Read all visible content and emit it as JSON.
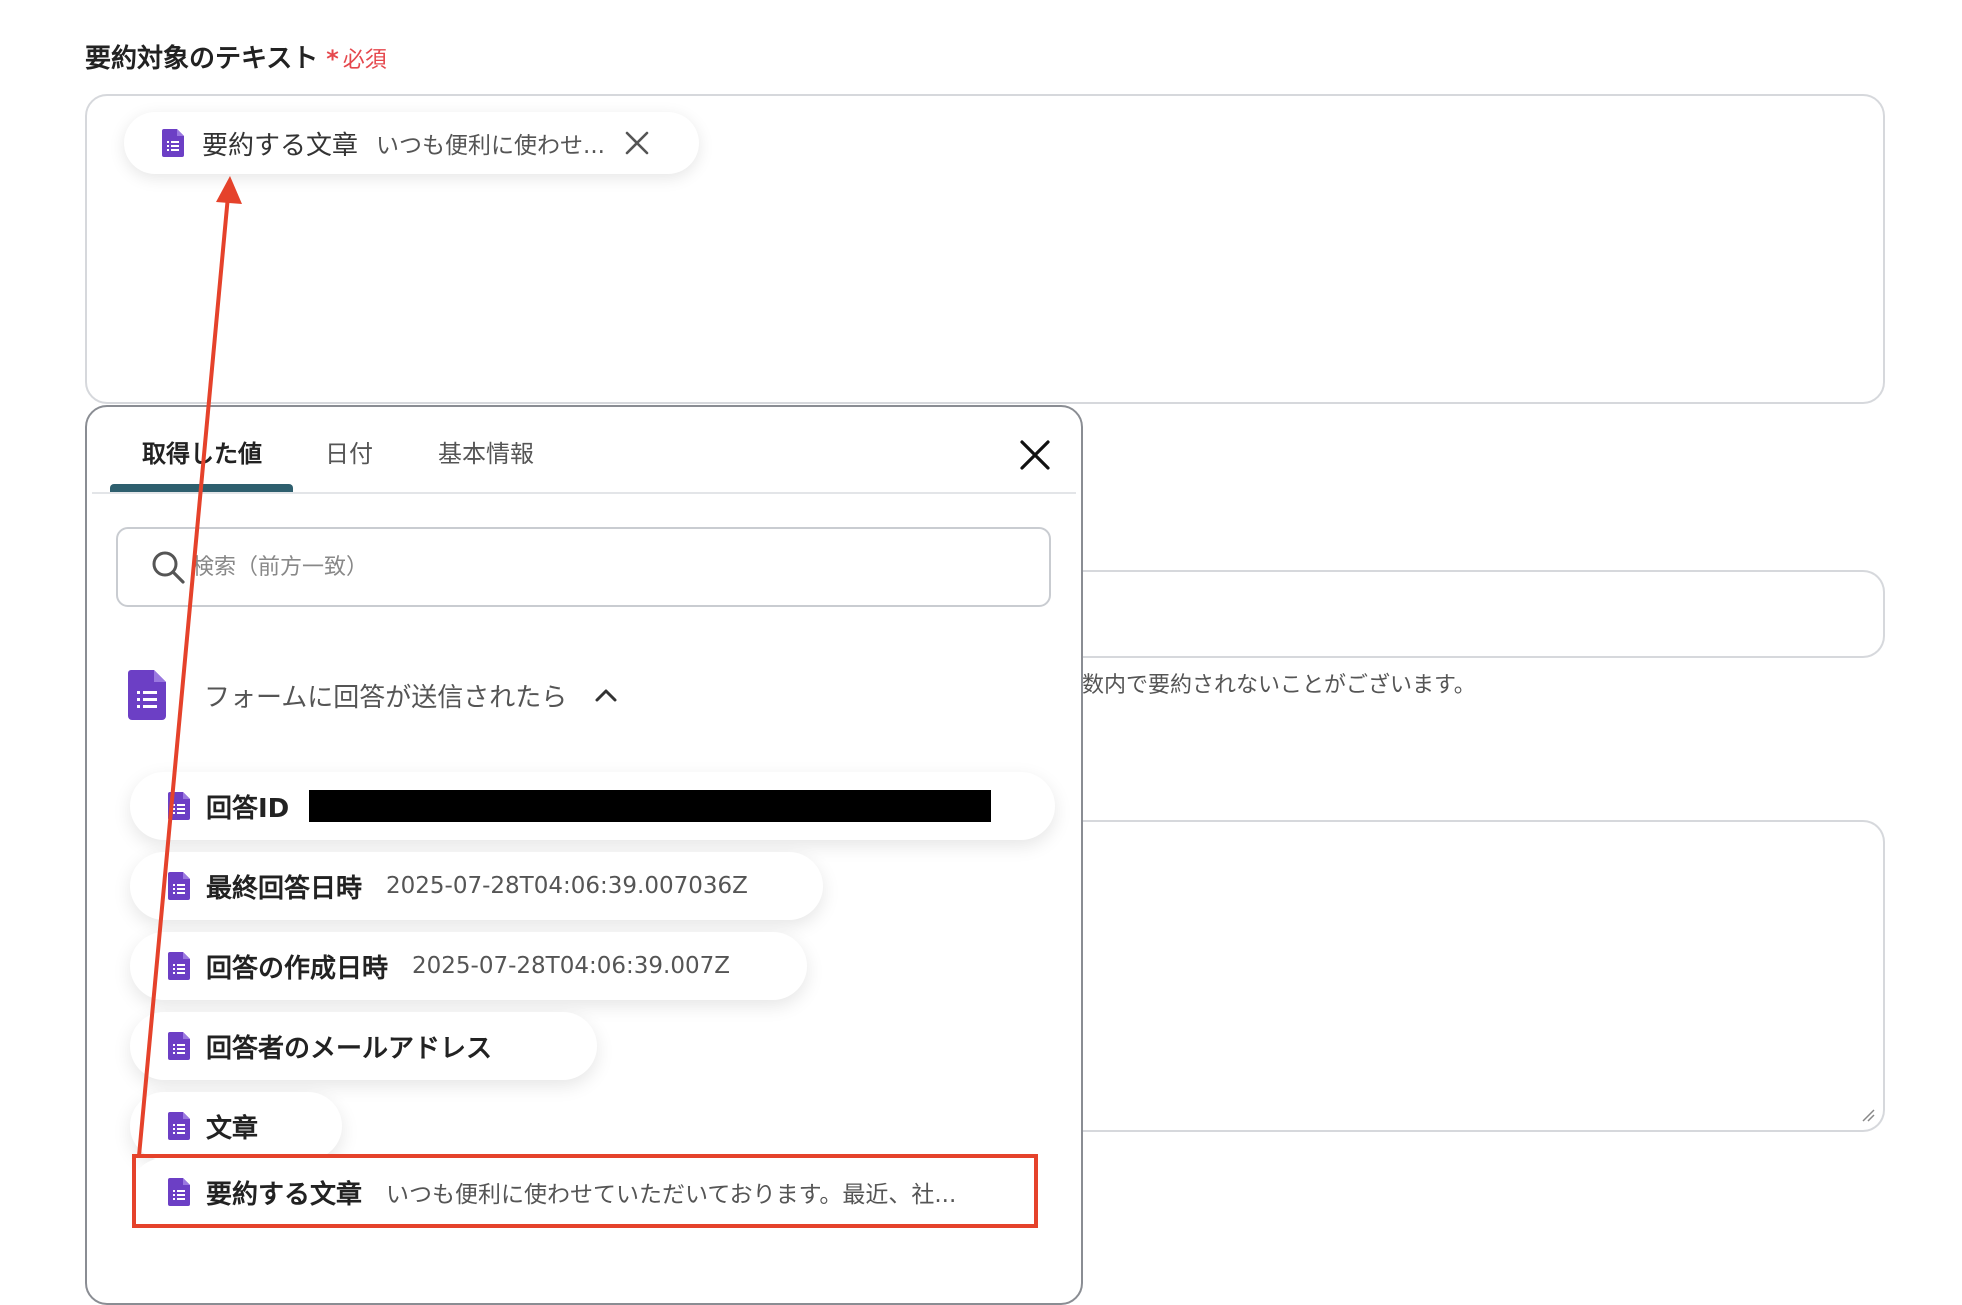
{
  "field": {
    "label": "要約対象のテキスト",
    "required_star": "*",
    "required_text": "必須"
  },
  "selected_chip": {
    "icon": "google-forms-doc-icon",
    "label": "要約する文章",
    "value": "いつも便利に使わせ...",
    "remove_icon": "close-icon"
  },
  "background": {
    "help_text": "数内で要約されないことがございます。"
  },
  "popup": {
    "tabs": [
      "取得した値",
      "日付",
      "基本情報"
    ],
    "active_tab": 0,
    "search_placeholder": "検索（前方一致）",
    "group": {
      "label": "フォームに回答が送信されたら",
      "expanded": true
    },
    "items": [
      {
        "label": "回答ID",
        "value": "",
        "redacted": true
      },
      {
        "label": "最終回答日時",
        "value": "2025-07-28T04:06:39.007036Z"
      },
      {
        "label": "回答の作成日時",
        "value": "2025-07-28T04:06:39.007Z"
      },
      {
        "label": "回答者のメールアドレス",
        "value": ""
      },
      {
        "label": "文章",
        "value": ""
      },
      {
        "label": "要約する文章",
        "value": "いつも便利に使わせていただいております。最近、社..."
      }
    ]
  },
  "colors": {
    "required": "#e5484d",
    "tab_underline": "#2e5f6e",
    "forms_purple": "#6c3fc5",
    "annotation_red": "#e5422b"
  }
}
